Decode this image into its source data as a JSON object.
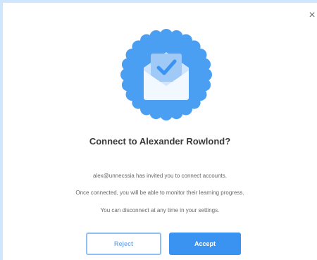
{
  "dialog": {
    "close_glyph": "×",
    "title": "Connect to Alexander Rowlond?",
    "messages": [
      "alex@unnecssia has invited you to connect accounts.",
      "Once connected, you will be able to monitor their learning progress.",
      "You can disconnect at any time in your settings."
    ],
    "reject_label": "Reject",
    "accept_label": "Accept",
    "badge_icon": "envelope-checkmark-icon"
  },
  "colors": {
    "accent": "#3a93f0",
    "badge": "#4a9ff2",
    "envelope_light": "#dceeff",
    "backdrop": "#cfe6ff"
  }
}
